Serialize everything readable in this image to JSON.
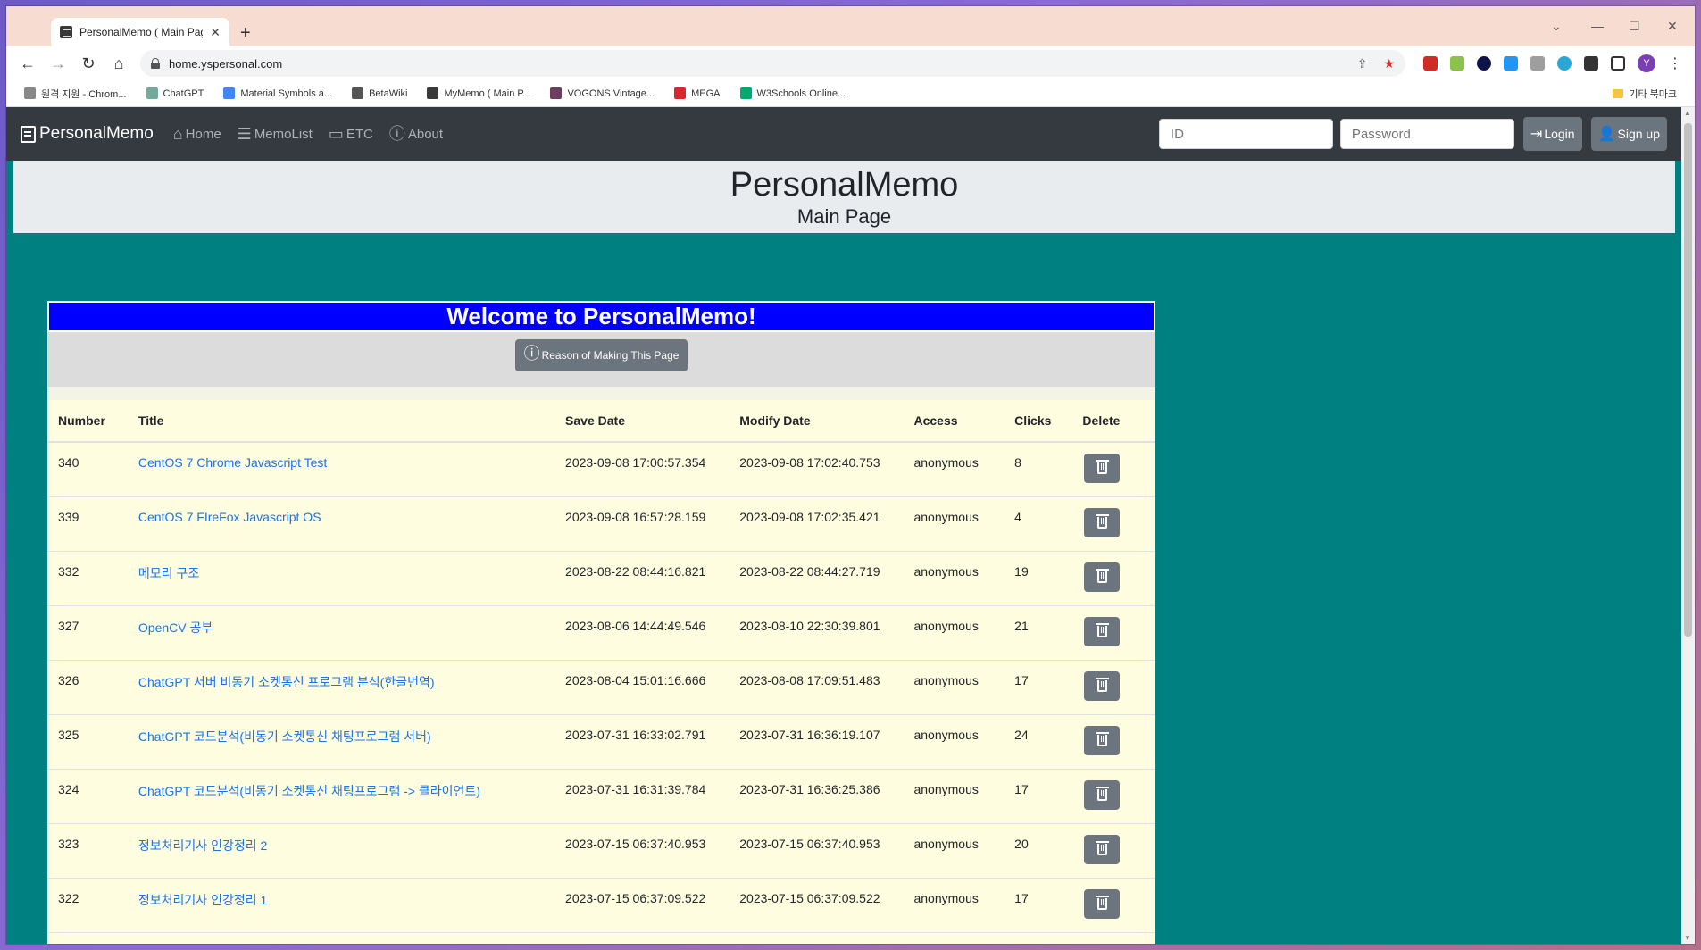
{
  "browser": {
    "tab_title": "PersonalMemo ( Main Page )",
    "url": "home.yspersonal.com",
    "avatar_letter": "Y",
    "bookmarks": [
      {
        "label": "원격 지원 - Chrom...",
        "color": "#888"
      },
      {
        "label": "ChatGPT",
        "color": "#74aa9c"
      },
      {
        "label": "Material Symbols a...",
        "color": "#4285f4"
      },
      {
        "label": "BetaWiki",
        "color": "#555"
      },
      {
        "label": "MyMemo ( Main P...",
        "color": "#3a3a3a"
      },
      {
        "label": "VOGONS Vintage...",
        "color": "#6b3e5e"
      },
      {
        "label": "MEGA",
        "color": "#d9272e"
      },
      {
        "label": "W3Schools Online...",
        "color": "#04aa6d"
      }
    ],
    "other_bookmarks": "기타 북마크"
  },
  "navbar": {
    "brand": "PersonalMemo",
    "links": [
      {
        "label": "Home",
        "icon": "home-icon",
        "glyph": "⌂"
      },
      {
        "label": "MemoList",
        "icon": "list-icon",
        "glyph": "☰"
      },
      {
        "label": "ETC",
        "icon": "label-icon",
        "glyph": "▭"
      },
      {
        "label": "About",
        "icon": "info-icon",
        "glyph": "ⓘ"
      }
    ],
    "id_placeholder": "ID",
    "password_placeholder": "Password",
    "login_label": "Login",
    "signup_label": "Sign up"
  },
  "header": {
    "title": "PersonalMemo",
    "subtitle": "Main Page"
  },
  "main": {
    "welcome": "Welcome to PersonalMemo!",
    "reason_button": "Reason of Making This Page",
    "columns": [
      "Number",
      "Title",
      "Save Date",
      "Modify Date",
      "Access",
      "Clicks",
      "Delete"
    ],
    "rows": [
      {
        "number": "340",
        "title": "CentOS 7 Chrome Javascript Test",
        "save": "2023-09-08 17:00:57.354",
        "modify": "2023-09-08 17:02:40.753",
        "access": "anonymous",
        "clicks": "8"
      },
      {
        "number": "339",
        "title": "CentOS 7 FIreFox Javascript OS",
        "save": "2023-09-08 16:57:28.159",
        "modify": "2023-09-08 17:02:35.421",
        "access": "anonymous",
        "clicks": "4"
      },
      {
        "number": "332",
        "title": "메모리 구조",
        "save": "2023-08-22 08:44:16.821",
        "modify": "2023-08-22 08:44:27.719",
        "access": "anonymous",
        "clicks": "19"
      },
      {
        "number": "327",
        "title": "OpenCV 공부",
        "save": "2023-08-06 14:44:49.546",
        "modify": "2023-08-10 22:30:39.801",
        "access": "anonymous",
        "clicks": "21"
      },
      {
        "number": "326",
        "title": "ChatGPT 서버 비동기 소켓통신 프로그램 분석(한글번역)",
        "save": "2023-08-04 15:01:16.666",
        "modify": "2023-08-08 17:09:51.483",
        "access": "anonymous",
        "clicks": "17"
      },
      {
        "number": "325",
        "title": "ChatGPT 코드분석(비동기 소켓통신 채팅프로그램 서버)",
        "save": "2023-07-31 16:33:02.791",
        "modify": "2023-07-31 16:36:19.107",
        "access": "anonymous",
        "clicks": "24"
      },
      {
        "number": "324",
        "title": "ChatGPT 코드분석(비동기 소켓통신 채팅프로그램 -> 클라이언트)",
        "save": "2023-07-31 16:31:39.784",
        "modify": "2023-07-31 16:36:25.386",
        "access": "anonymous",
        "clicks": "17"
      },
      {
        "number": "323",
        "title": "정보처리기사 인강정리 2",
        "save": "2023-07-15 06:37:40.953",
        "modify": "2023-07-15 06:37:40.953",
        "access": "anonymous",
        "clicks": "20"
      },
      {
        "number": "322",
        "title": "정보처리기사 인강정리 1",
        "save": "2023-07-15 06:37:09.522",
        "modify": "2023-07-15 06:37:09.522",
        "access": "anonymous",
        "clicks": "17"
      }
    ]
  }
}
